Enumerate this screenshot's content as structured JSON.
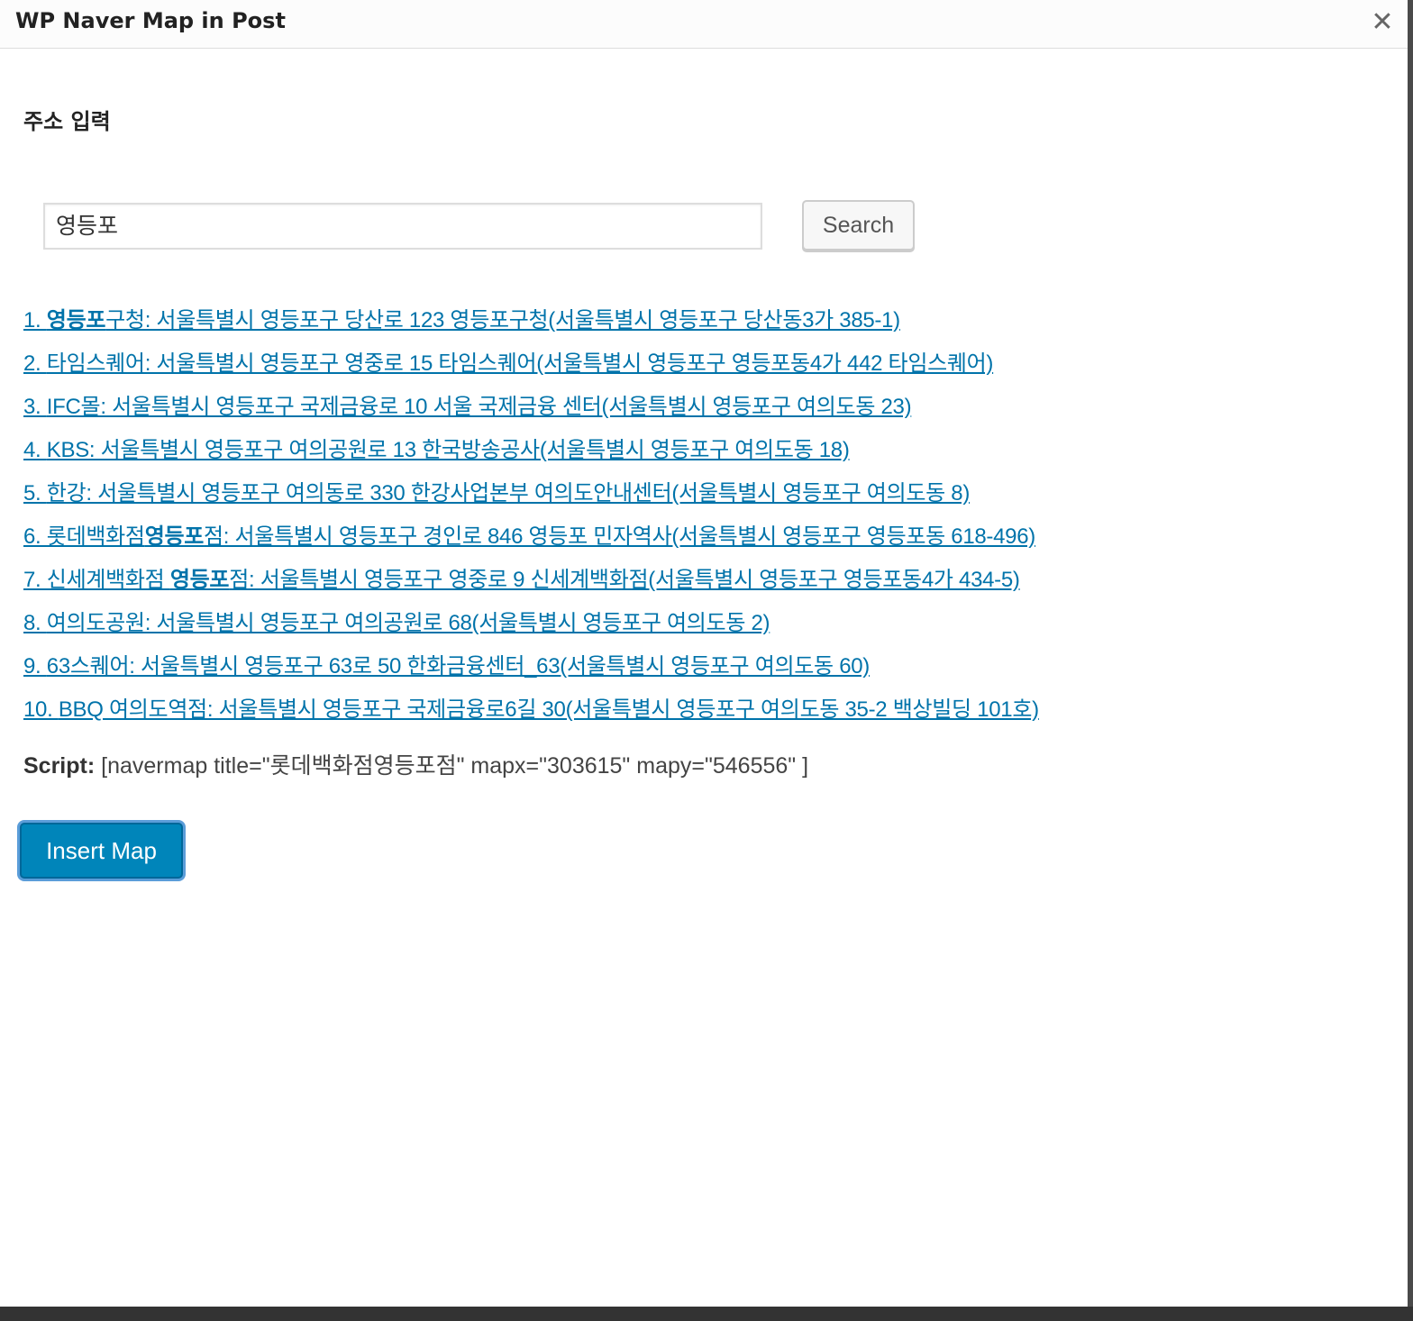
{
  "dialog": {
    "title": "WP Naver Map in Post",
    "close_icon": "close-icon"
  },
  "form": {
    "heading": "주소 입력",
    "search_value": "영등포",
    "search_button": "Search"
  },
  "results": [
    {
      "prefix": "1. ",
      "bold": "영등포",
      "rest": "구청: 서울특별시 영등포구 당산로 123 영등포구청(서울특별시 영등포구 당산동3가 385-1)"
    },
    {
      "prefix": "2. ",
      "bold": "",
      "rest": "타임스퀘어: 서울특별시 영등포구 영중로 15 타임스퀘어(서울특별시 영등포구 영등포동4가 442 타임스퀘어)"
    },
    {
      "prefix": "3. ",
      "bold": "",
      "rest": "IFC몰: 서울특별시 영등포구 국제금융로 10 서울 국제금융 센터(서울특별시 영등포구 여의도동 23)"
    },
    {
      "prefix": "4. ",
      "bold": "",
      "rest": "KBS: 서울특별시 영등포구 여의공원로 13 한국방송공사(서울특별시 영등포구 여의도동 18)"
    },
    {
      "prefix": "5. ",
      "bold": "",
      "rest": "한강: 서울특별시 영등포구 여의동로 330 한강사업본부 여의도안내센터(서울특별시 영등포구 여의도동 8)"
    },
    {
      "prefix": "6. 롯데백화점",
      "bold": "영등포",
      "rest": "점: 서울특별시 영등포구 경인로 846 영등포 민자역사(서울특별시 영등포구 영등포동 618-496)"
    },
    {
      "prefix": "7. 신세계백화점 ",
      "bold": "영등포",
      "rest": "점: 서울특별시 영등포구 영중로 9 신세계백화점(서울특별시 영등포구 영등포동4가 434-5)"
    },
    {
      "prefix": "8. ",
      "bold": "",
      "rest": "여의도공원: 서울특별시 영등포구 여의공원로 68(서울특별시 영등포구 여의도동 2)"
    },
    {
      "prefix": "9. ",
      "bold": "",
      "rest": "63스퀘어: 서울특별시 영등포구 63로 50 한화금융센터_63(서울특별시 영등포구 여의도동 60)"
    },
    {
      "prefix": "10. ",
      "bold": "",
      "rest": "BBQ 여의도역점: 서울특별시 영등포구 국제금융로6길 30(서울특별시 영등포구 여의도동 35-2 백상빌딩 101호)"
    }
  ],
  "script": {
    "label": "Script:",
    "value": "[navermap title=\"롯데백화점영등포점\" mapx=\"303615\" mapy=\"546556\" ]"
  },
  "insert_button": "Insert Map",
  "colors": {
    "link": "#0073aa",
    "primary_button": "#0085ba"
  }
}
